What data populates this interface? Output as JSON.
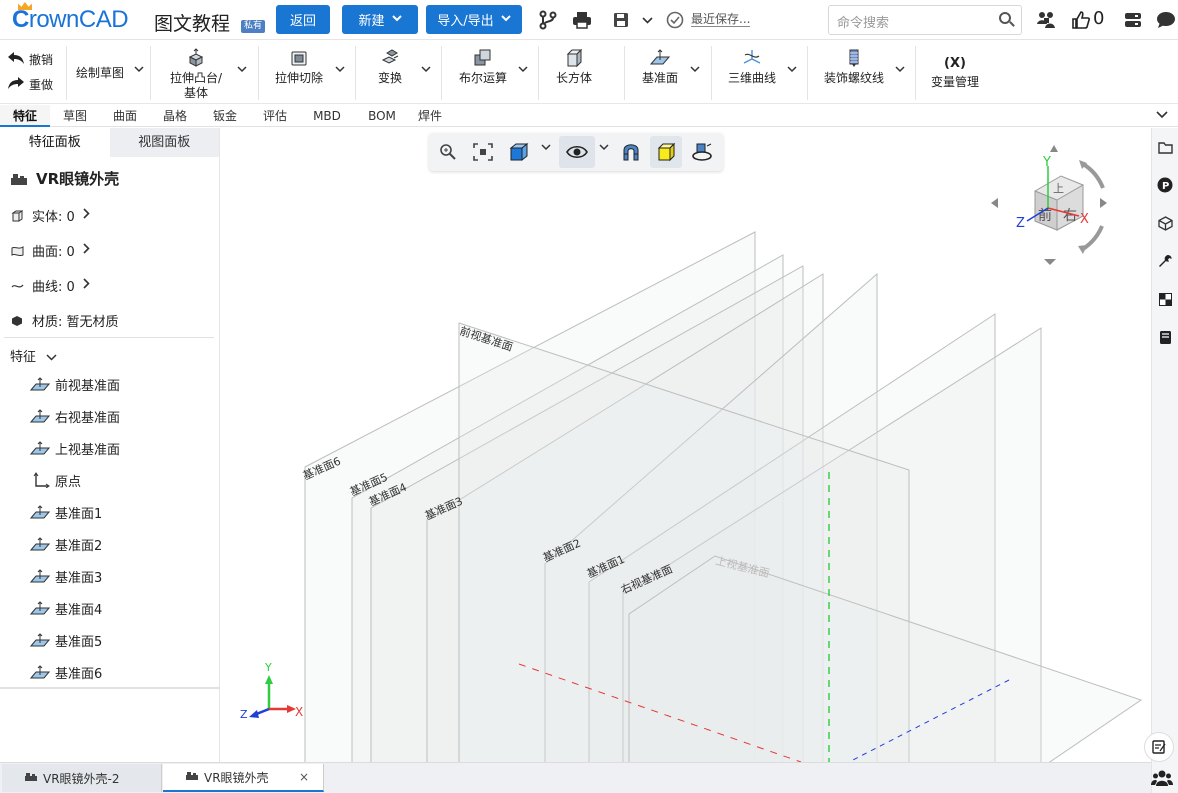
{
  "header": {
    "logo_text": "rownCAD",
    "logo_letter": "C",
    "title": "图文教程",
    "private_badge": "私有",
    "back_button": "返回",
    "new_button": "新建",
    "import_export_button": "导入/导出",
    "save_status": "最近保存...",
    "search_placeholder": "命令搜索",
    "like_count": "0"
  },
  "ribbon": {
    "undo": "撤销",
    "redo": "重做",
    "sketch": "绘制草图",
    "extrude_line1": "拉伸凸台/",
    "extrude_line2": "基体",
    "extrude_cut": "拉伸切除",
    "transform": "变换",
    "boolean": "布尔运算",
    "box": "长方体",
    "datum_plane": "基准面",
    "curve_3d": "三维曲线",
    "thread": "装饰螺纹线",
    "var_icon": "(X)",
    "variables": "变量管理"
  },
  "tabs": [
    "特征",
    "草图",
    "曲面",
    "晶格",
    "钣金",
    "评估",
    "MBD",
    "BOM",
    "焊件"
  ],
  "left_panel": {
    "tab_features": "特征面板",
    "tab_view": "视图面板",
    "model_name": "VR眼镜外壳",
    "solids": "实体: 0",
    "surfaces": "曲面: 0",
    "curves": "曲线: 0",
    "material": "材质:  暂无材质",
    "features_header": "特征",
    "features": [
      "前视基准面",
      "右视基准面",
      "上视基准面",
      "原点",
      "基准面1",
      "基准面2",
      "基准面3",
      "基准面4",
      "基准面5",
      "基准面6"
    ]
  },
  "viewport": {
    "plane_labels": {
      "front": "前视基准面",
      "right": "右视基准面",
      "top": "上视基准面",
      "p1": "基准面1",
      "p2": "基准面2",
      "p3": "基准面3",
      "p4": "基准面4",
      "p5": "基准面5",
      "p6": "基准面6"
    },
    "cube_front": "前",
    "cube_right": "右",
    "cube_top": "上",
    "axis_x": "X",
    "axis_y": "Y",
    "axis_z": "Z"
  },
  "bottom_tabs": {
    "tab1": "VR眼镜外壳-2",
    "tab2": "VR眼镜外壳",
    "close": "×"
  },
  "colors": {
    "primary": "#1976d2",
    "axis_x": "#e53935",
    "axis_y": "#2ecc40",
    "axis_z": "#1e3fd8"
  }
}
